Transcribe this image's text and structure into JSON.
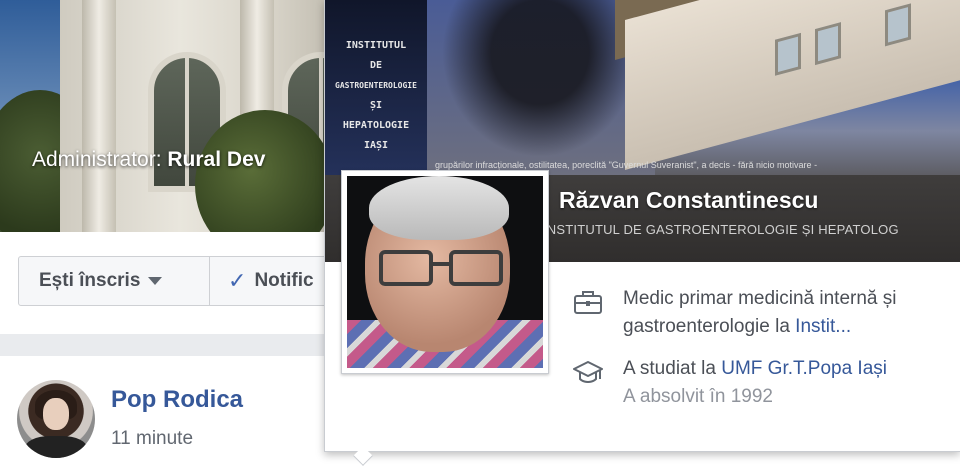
{
  "group": {
    "admin_label": "Administrator:",
    "admin_name": "Rural Dev",
    "joined_button": "Ești înscris",
    "notifications_button": "Notific"
  },
  "post": {
    "author": "Pop Rodica",
    "time": "11 minute"
  },
  "hovercard": {
    "name": "Răzvan Constantinescu",
    "subtitle": "INSTITUTUL DE GASTROENTEROLOGIE ȘI HEPATOLOG",
    "cover_sign": [
      "INSTITUTUL",
      "DE",
      "GASTROENTEROLOGIE",
      "ȘI",
      "HEPATOLOGIE",
      "IAȘI"
    ],
    "cover_ticker": "grupărilor infracționale, ostilitatea, poreclită \"Guvernul Suveranist\", a decis - fără nicio motivare -",
    "work": {
      "text_line1": "Medic primar medicină internă și",
      "text_line2": "gastroenterologie la ",
      "link": "Instit...",
      "icon": "briefcase-icon"
    },
    "education": {
      "prefix": "A studiat la ",
      "link": "UMF Gr.T.Popa Iași",
      "detail": "A absolvit în 1992",
      "icon": "graduation-cap-icon"
    }
  },
  "colors": {
    "link": "#365899",
    "text": "#4b4f56",
    "muted": "#90949c",
    "check": "#4267b2"
  }
}
